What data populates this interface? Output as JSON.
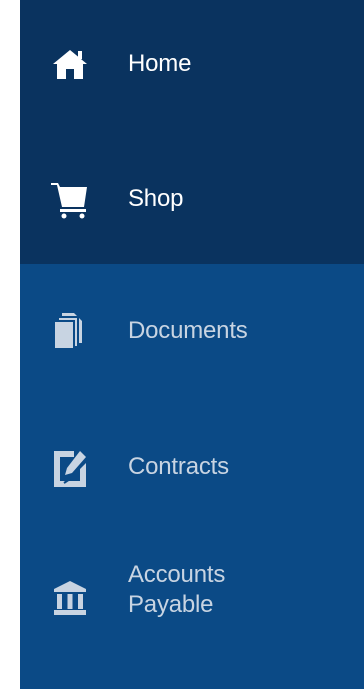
{
  "sidebar": {
    "items": [
      {
        "label": "Home",
        "icon": "home-icon",
        "state": "active"
      },
      {
        "label": "Shop",
        "icon": "cart-icon",
        "state": "active"
      },
      {
        "label": "Documents",
        "icon": "documents-icon",
        "state": "inactive"
      },
      {
        "label": "Contracts",
        "icon": "contract-edit-icon",
        "state": "inactive"
      },
      {
        "label": "Accounts Payable",
        "label_line1": "Accounts",
        "label_line2": "Payable",
        "icon": "bank-icon",
        "state": "inactive"
      }
    ]
  },
  "colors": {
    "top_background": "#0a335f",
    "main_background": "#0b4a86",
    "active_text": "#ffffff",
    "inactive_text": "#c8d4e2"
  }
}
